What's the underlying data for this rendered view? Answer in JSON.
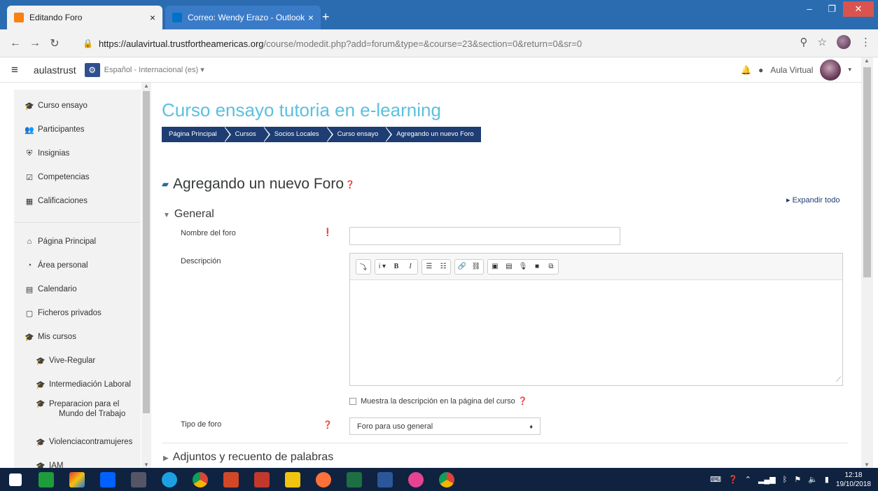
{
  "browser": {
    "tabs": [
      {
        "title": "Editando Foro",
        "active": true,
        "favicon_color": "#f98012"
      },
      {
        "title": "Correo: Wendy Erazo - Outlook",
        "active": false,
        "favicon_color": "#0072c6"
      }
    ],
    "close_glyph": "×",
    "new_tab_glyph": "+",
    "url_host": "https://aulavirtual.trustfortheamericas.org",
    "url_path": "/course/modedit.php?add=forum&type=&course=23&section=0&return=0&sr=0"
  },
  "navbar": {
    "brand": "aulastrust",
    "language": "Español - Internacional (es) ▾",
    "user_name": "Aula Virtual"
  },
  "sidebar": {
    "items": [
      {
        "label": "Curso ensayo",
        "icon": "graduation-cap-icon"
      },
      {
        "label": "Participantes",
        "icon": "users-icon"
      },
      {
        "label": "Insignias",
        "icon": "shield-icon"
      },
      {
        "label": "Competencias",
        "icon": "check-square-icon"
      },
      {
        "label": "Calificaciones",
        "icon": "table-icon"
      }
    ],
    "items2": [
      {
        "label": "Página Principal",
        "icon": "home-icon"
      },
      {
        "label": "Área personal",
        "icon": "dashboard-icon"
      },
      {
        "label": "Calendario",
        "icon": "calendar-icon"
      },
      {
        "label": "Ficheros privados",
        "icon": "file-icon"
      },
      {
        "label": "Mis cursos",
        "icon": "graduation-cap-icon"
      }
    ],
    "courses": [
      "Vive-Regular",
      "Intermediación Laboral",
      "Preparacion para el",
      "Mundo del Trabajo",
      "Violenciacontramujeres",
      "IAM"
    ]
  },
  "page": {
    "course_title": "Curso ensayo tutoria en e-learning",
    "breadcrumb": [
      "Página Principal",
      "Cursos",
      "Socios Locales",
      "Curso ensayo",
      "Agregando un nuevo Foro"
    ],
    "heading": "Agregando un nuevo Foro",
    "expand_all": "Expandir todo",
    "section_general": "General",
    "field_name_label": "Nombre del foro",
    "field_name_value": "",
    "field_desc_label": "Descripción",
    "show_desc_label": "Muestra la descripción en la página del curso",
    "forum_type_label": "Tipo de foro",
    "forum_type_value": "Foro para uso general",
    "section_attachments": "Adjuntos y recuento de palabras"
  },
  "editor": {
    "toolbar_groups": [
      [
        "⤵"
      ],
      [
        "i ▾",
        "B",
        "I"
      ],
      [
        "☰",
        "☷"
      ],
      [
        "🔗",
        "⛓"
      ],
      [
        "▣",
        "▤",
        "🎙",
        "■",
        "⧉"
      ]
    ]
  },
  "taskbar": {
    "time": "12:18",
    "date": "19/10/2018"
  },
  "colors": {
    "accent": "#5bc0de",
    "breadcrumb_bg": "#1d3d73",
    "required": "#d9534f",
    "help": "#1d6f9f"
  }
}
